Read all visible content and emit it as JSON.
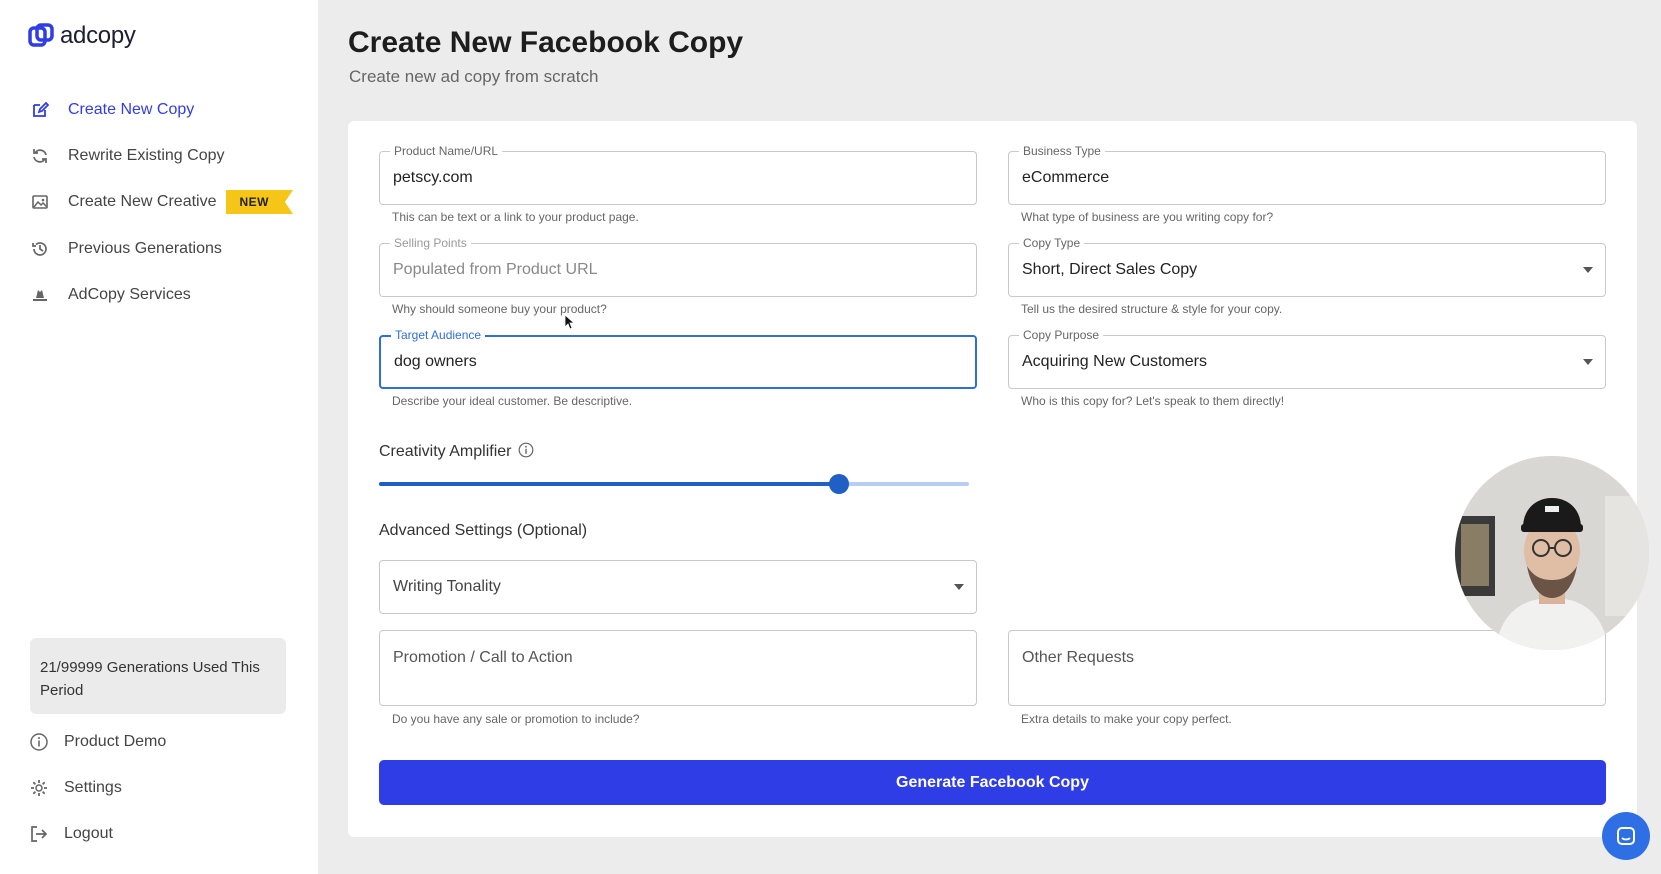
{
  "brand": {
    "name": "adcopy",
    "accent": "#2f3de6"
  },
  "sidebar": {
    "items": [
      {
        "label": "Create New Copy",
        "icon": "edit-icon",
        "active": true
      },
      {
        "label": "Rewrite Existing Copy",
        "icon": "refresh-icon",
        "active": false
      },
      {
        "label": "Create New Creative",
        "icon": "image-icon",
        "active": false,
        "badge": "NEW"
      },
      {
        "label": "Previous Generations",
        "icon": "history-icon",
        "active": false
      },
      {
        "label": "AdCopy Services",
        "icon": "hat-icon",
        "active": false
      }
    ],
    "usage": "21/99999 Generations Used This Period",
    "bottom": [
      {
        "label": "Product Demo",
        "icon": "info-icon"
      },
      {
        "label": "Settings",
        "icon": "gear-icon"
      },
      {
        "label": "Logout",
        "icon": "logout-icon"
      }
    ]
  },
  "main": {
    "title": "Create New Facebook Copy",
    "subtitle": "Create new ad copy from scratch",
    "fields": {
      "product": {
        "label": "Product Name/URL",
        "value": "petscy.com",
        "helper": "This can be text or a link to your product page."
      },
      "business_type": {
        "label": "Business Type",
        "value": "eCommerce",
        "helper": "What type of business are you writing copy for?"
      },
      "selling_points": {
        "label": "Selling Points",
        "placeholder": "Populated from Product URL",
        "helper": "Why should someone buy your product?"
      },
      "copy_type": {
        "label": "Copy Type",
        "value": "Short, Direct Sales Copy",
        "helper": "Tell us the desired structure & style for your copy."
      },
      "target_audience": {
        "label": "Target Audience",
        "value": "dog owners",
        "helper": "Describe your ideal customer. Be descriptive."
      },
      "copy_purpose": {
        "label": "Copy Purpose",
        "value": "Acquiring New Customers",
        "helper": "Who is this copy for? Let's speak to them directly!"
      },
      "writing_tonality": {
        "placeholder": "Writing Tonality"
      },
      "promotion": {
        "placeholder": "Promotion / Call to Action",
        "helper": "Do you have any sale or promotion to include?"
      },
      "other_requests": {
        "placeholder": "Other Requests",
        "helper": "Extra details to make your copy perfect."
      }
    },
    "creativity": {
      "label": "Creativity Amplifier",
      "level": 0.78
    },
    "advanced_label": "Advanced Settings (Optional)",
    "generate_label": "Generate Facebook Copy"
  }
}
